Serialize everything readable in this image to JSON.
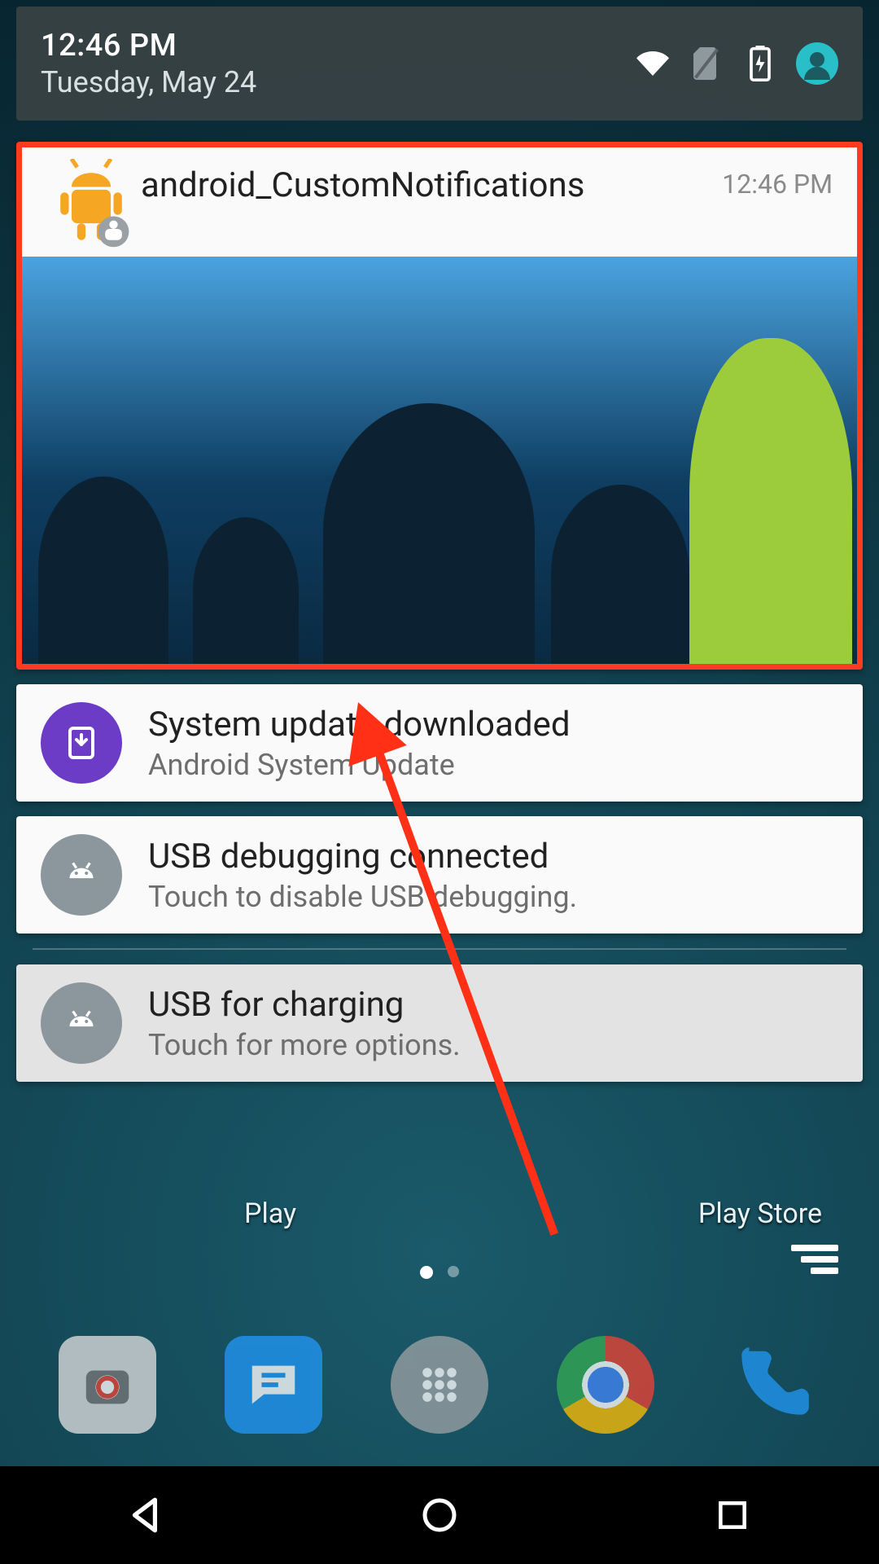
{
  "shade": {
    "time": "12:46 PM",
    "date": "Tuesday, May 24",
    "status_icons": [
      "wifi",
      "no-sim",
      "battery-charging",
      "profile"
    ]
  },
  "notifications": [
    {
      "app": "android_CustomNotifications",
      "time": "12:46 PM",
      "expanded_image": true,
      "highlight": true
    },
    {
      "icon": "download",
      "icon_color": "#6c3cc7",
      "title": "System update downloaded",
      "subtitle": "Android System Update"
    },
    {
      "icon": "android-head",
      "icon_color": "#8b979c",
      "title": "USB debugging connected",
      "subtitle": "Touch to disable USB debugging."
    },
    {
      "icon": "android-head",
      "icon_color": "#8b979c",
      "title": "USB for charging",
      "subtitle": "Touch for more options.",
      "dim": true
    }
  ],
  "home": {
    "label_left": "Play",
    "label_right": "Play Store",
    "dock": [
      "camera",
      "messenger",
      "app-drawer",
      "chrome",
      "phone"
    ]
  },
  "nav": [
    "back",
    "home",
    "recents"
  ]
}
